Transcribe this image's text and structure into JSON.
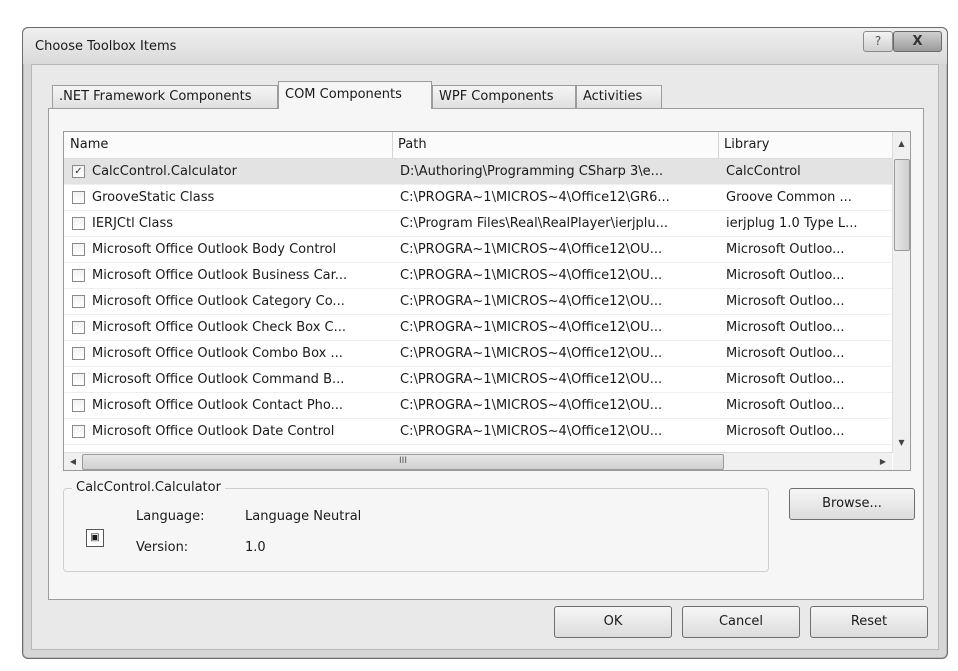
{
  "dialog": {
    "title": "Choose Toolbox Items",
    "help_label": "?",
    "close_label": "X"
  },
  "tabs": [
    {
      "label": ".NET Framework Components"
    },
    {
      "label": "COM Components"
    },
    {
      "label": "WPF Components"
    },
    {
      "label": "Activities"
    }
  ],
  "active_tab": "COM Components",
  "grid": {
    "columns": [
      "Name",
      "Path",
      "Library"
    ],
    "rows": [
      {
        "checked": true,
        "name": "CalcControl.Calculator",
        "path": "D:\\Authoring\\Programming CSharp 3\\e...",
        "library": "CalcControl"
      },
      {
        "checked": false,
        "name": "GrooveStatic Class",
        "path": "C:\\PROGRA~1\\MICROS~4\\Office12\\GR6...",
        "library": "Groove Common ..."
      },
      {
        "checked": false,
        "name": "IERJCtl Class",
        "path": "C:\\Program Files\\Real\\RealPlayer\\ierjplu...",
        "library": "ierjplug 1.0 Type L..."
      },
      {
        "checked": false,
        "name": "Microsoft Office Outlook Body Control",
        "path": "C:\\PROGRA~1\\MICROS~4\\Office12\\OU...",
        "library": "Microsoft Outloo..."
      },
      {
        "checked": false,
        "name": "Microsoft Office Outlook Business Car...",
        "path": "C:\\PROGRA~1\\MICROS~4\\Office12\\OU...",
        "library": "Microsoft Outloo..."
      },
      {
        "checked": false,
        "name": "Microsoft Office Outlook Category Co...",
        "path": "C:\\PROGRA~1\\MICROS~4\\Office12\\OU...",
        "library": "Microsoft Outloo..."
      },
      {
        "checked": false,
        "name": "Microsoft Office Outlook Check Box C...",
        "path": "C:\\PROGRA~1\\MICROS~4\\Office12\\OU...",
        "library": "Microsoft Outloo..."
      },
      {
        "checked": false,
        "name": "Microsoft Office Outlook Combo Box ...",
        "path": "C:\\PROGRA~1\\MICROS~4\\Office12\\OU...",
        "library": "Microsoft Outloo..."
      },
      {
        "checked": false,
        "name": "Microsoft Office Outlook Command B...",
        "path": "C:\\PROGRA~1\\MICROS~4\\Office12\\OU...",
        "library": "Microsoft Outloo..."
      },
      {
        "checked": false,
        "name": "Microsoft Office Outlook Contact Pho...",
        "path": "C:\\PROGRA~1\\MICROS~4\\Office12\\OU...",
        "library": "Microsoft Outloo..."
      },
      {
        "checked": false,
        "name": "Microsoft Office Outlook Date Control",
        "path": "C:\\PROGRA~1\\MICROS~4\\Office12\\OU...",
        "library": "Microsoft Outloo..."
      }
    ],
    "hscroll_grip": "III"
  },
  "info": {
    "group_title": "CalcControl.Calculator",
    "language_label": "Language:",
    "language_value": "Language Neutral",
    "version_label": "Version:",
    "version_value": "1.0"
  },
  "buttons": {
    "browse": "Browse...",
    "ok": "OK",
    "cancel": "Cancel",
    "reset": "Reset"
  }
}
